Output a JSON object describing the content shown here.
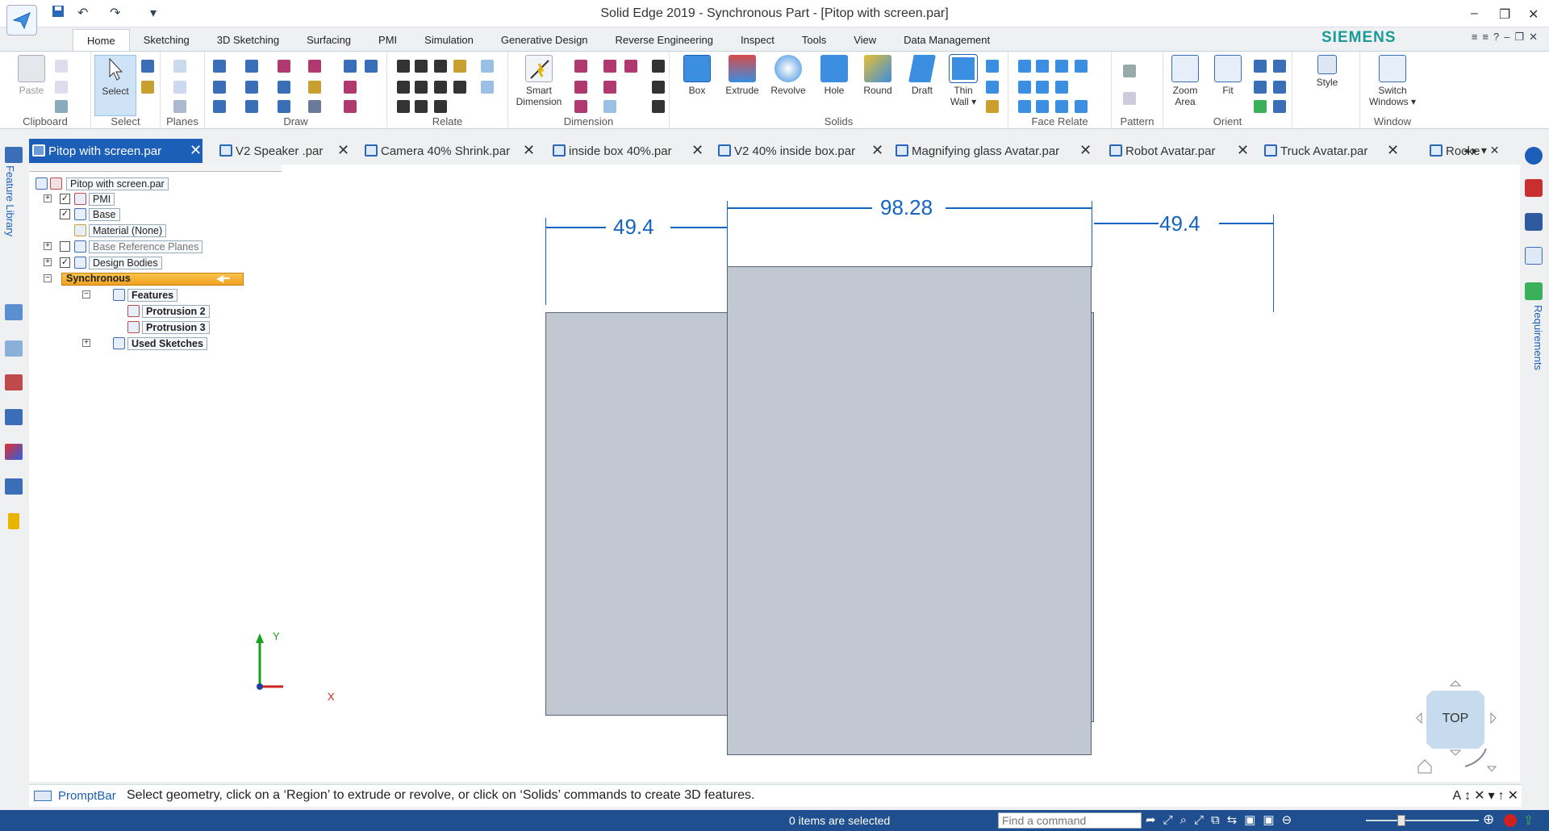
{
  "window": {
    "title": "Solid Edge 2019 - Synchronous Part - [Pitop with screen.par]",
    "minimize": "–",
    "restore": "❐",
    "close": "✕"
  },
  "qat": {
    "save_icon": "save-icon",
    "undo": "↶",
    "redo": "↷",
    "more": "▾"
  },
  "ribbon_tabs": [
    "Home",
    "Sketching",
    "3D Sketching",
    "Surfacing",
    "PMI",
    "Simulation",
    "Generative Design",
    "Reverse Engineering",
    "Inspect",
    "Tools",
    "View",
    "Data Management"
  ],
  "active_tab": "Home",
  "brand": "SIEMENS",
  "ribbon_right_icons": "≡≡?–❐✕",
  "ribbon": {
    "clipboard": {
      "label": "Clipboard",
      "paste": "Paste"
    },
    "select": {
      "label": "Select",
      "select": "Select"
    },
    "planes": {
      "label": "Planes"
    },
    "draw": {
      "label": "Draw"
    },
    "relate": {
      "label": "Relate"
    },
    "dimension": {
      "label": "Dimension",
      "smart_dimension_1": "Smart",
      "smart_dimension_2": "Dimension"
    },
    "solids": {
      "label": "Solids",
      "box": "Box",
      "extrude": "Extrude",
      "revolve": "Revolve",
      "hole": "Hole",
      "round": "Round",
      "draft": "Draft",
      "thin_wall_1": "Thin",
      "thin_wall_2": "Wall ▾"
    },
    "face_relate": {
      "label": "Face Relate"
    },
    "pattern": {
      "label": "Pattern"
    },
    "orient": {
      "label": "Orient",
      "zoom_area_1": "Zoom",
      "zoom_area_2": "Area",
      "fit": "Fit"
    },
    "style": {
      "label": "Style"
    },
    "window": {
      "label": "Window",
      "switch_windows_1": "Switch",
      "switch_windows_2": "Windows ▾"
    }
  },
  "doc_tabs": [
    {
      "label": "Pitop with screen.par",
      "active": true
    },
    {
      "label": "V2 Speaker .par"
    },
    {
      "label": "Camera 40% Shrink.par"
    },
    {
      "label": "inside box 40%.par"
    },
    {
      "label": "V2 40% inside box.par"
    },
    {
      "label": "Magnifying glass Avatar.par"
    },
    {
      "label": "Robot Avatar.par"
    },
    {
      "label": "Truck Avatar.par"
    },
    {
      "label": "Rocke"
    }
  ],
  "doc_tab_close": "✕",
  "doc_tab_controls": "◂ ▸ ▾ ✕",
  "left_strip": {
    "feature_library": "Feature Library"
  },
  "right_strip": {
    "requirements": "Requirements"
  },
  "pathfinder": {
    "root": "Pitop with screen.par",
    "items": [
      {
        "label": "PMI",
        "checked": true
      },
      {
        "label": "Base",
        "checked": true
      },
      {
        "label": "Material (None)"
      },
      {
        "label": "Base Reference Planes",
        "checked": false
      },
      {
        "label": "Design Bodies",
        "checked": true
      },
      {
        "label": "Synchronous"
      },
      {
        "label": "Features"
      },
      {
        "label": "Protrusion 2"
      },
      {
        "label": "Protrusion 3"
      },
      {
        "label": "Used Sketches"
      }
    ]
  },
  "canvas": {
    "dimensions": [
      {
        "value": "49.4"
      },
      {
        "value": "98.28"
      },
      {
        "value": "49.4"
      }
    ],
    "axis": {
      "y": "Y",
      "x": "X"
    },
    "view_cube": "TOP"
  },
  "prompt_bar": {
    "label": "PromptBar",
    "text": "Select geometry, click on a ‘Region’ to extrude or revolve, or click on ‘Solids’ commands to create 3D features.",
    "tools": "A↕✕▾↑✕"
  },
  "status_bar": {
    "selection": "0 items are selected",
    "find_placeholder": "Find a command",
    "icons": "➦⤢⌕⤢⧉⇆▣▣⊖",
    "zoom_level": 0.3
  },
  "colors": {
    "accent": "#1c5fb8",
    "dimension": "#1565c0",
    "body": "#c2c8d1",
    "brand": "#1b9a9a",
    "status": "#1f4f8e"
  }
}
